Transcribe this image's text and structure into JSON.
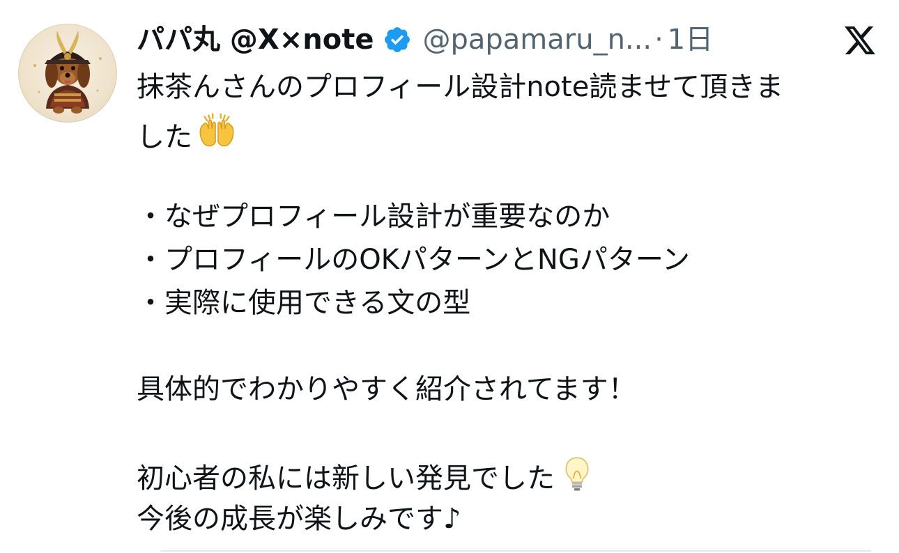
{
  "author": {
    "display_name": "パパ丸 @X×note",
    "handle": "@papamaru_n...",
    "separator": "·",
    "time": "1日",
    "verified_icon": "verified-badge-icon",
    "avatar_icon": "samurai-dachshund-avatar"
  },
  "platform_icon": "x-logo-icon",
  "tweet": {
    "line1": "抹茶んさんのプロフィール設計note読ませて頂きま",
    "line2": "した",
    "bullet1": "・なぜプロフィール設計が重要なのか",
    "bullet2": "・プロフィールのOKパターンとNGパターン",
    "bullet3": "・実際に使用できる文の型",
    "line3": "具体的でわかりやすく紹介されてます！",
    "line4": "初心者の私には新しい発見でした",
    "line5": "今後の成長が楽しみです♪",
    "emoji1": "raising-hands-emoji",
    "emoji2": "light-bulb-emoji"
  },
  "colors": {
    "text": "#0f1419",
    "secondary": "#536471",
    "verified": "#1d9bf0"
  }
}
